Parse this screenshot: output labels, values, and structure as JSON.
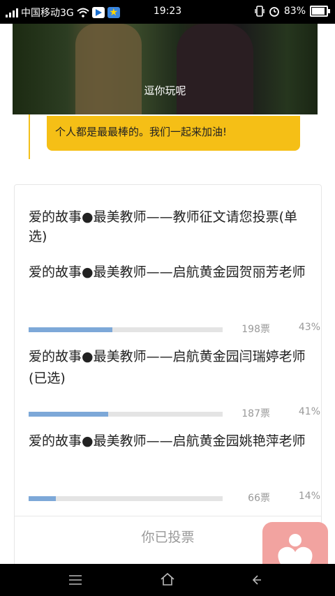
{
  "status_bar": {
    "carrier": "中国移动3G",
    "time": "19:23",
    "battery": "83%",
    "battery_level": 0.83,
    "icons": [
      "signal-icon",
      "wifi-icon",
      "video-app-icon",
      "star-app-icon",
      "vibrate-icon",
      "alarm-icon",
      "battery-icon"
    ]
  },
  "video": {
    "caption": "逗你玩呢"
  },
  "bubble": {
    "text": "个人都是最最棒的。我们一起来加油!"
  },
  "poll": {
    "title": "爱的故事●最美教师——教师征文请您投票(单选)",
    "options": [
      {
        "label": "爱的故事●最美教师——启航黄金园贺丽芳老师",
        "votes": "198票",
        "percent": "43%",
        "fraction": 0.43
      },
      {
        "label": "爱的故事●最美教师——启航黄金园闫瑞婷老师 (已选)",
        "votes": "187票",
        "percent": "41%",
        "fraction": 0.41
      },
      {
        "label": "爱的故事●最美教师——启航黄金园姚艳萍老师",
        "votes": "66票",
        "percent": "14%",
        "fraction": 0.14
      }
    ],
    "voted_label": "你已投票"
  },
  "colors": {
    "accent_yellow": "#f5bf16",
    "bar_fill": "#7da8d8",
    "heart_bg": "#f2a3a0"
  },
  "nav": {
    "icons": [
      "menu-icon",
      "home-icon",
      "back-icon"
    ]
  }
}
